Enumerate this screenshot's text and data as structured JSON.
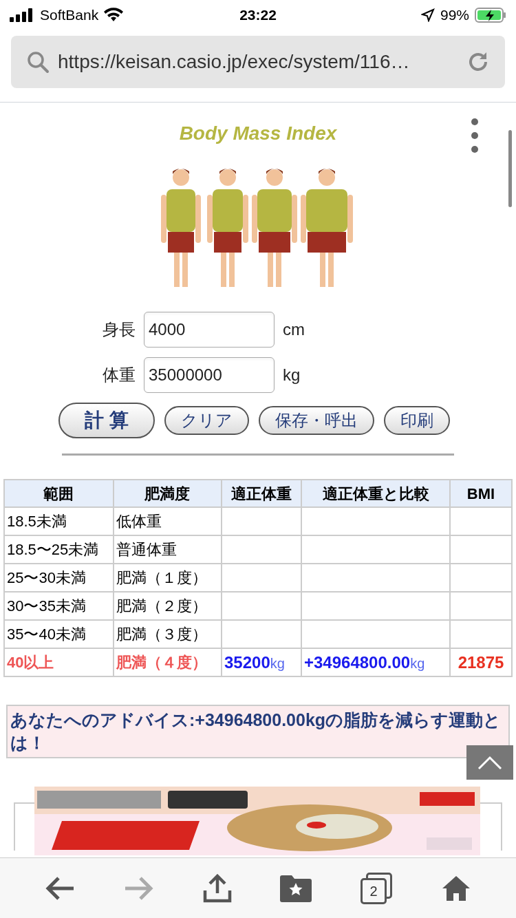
{
  "status_bar": {
    "carrier": "SoftBank",
    "time": "23:22",
    "battery": "99%"
  },
  "url_bar": {
    "url": "https://keisan.casio.jp/exec/system/116…"
  },
  "logo": {
    "title": "Body Mass Index"
  },
  "form": {
    "fields": [
      {
        "label": "身長",
        "value": "4000",
        "unit": "cm"
      },
      {
        "label": "体重",
        "value": "35000000",
        "unit": "kg"
      }
    ],
    "buttons": [
      {
        "label": "計 算",
        "kind": "primary"
      },
      {
        "label": "クリア",
        "kind": "secondary"
      },
      {
        "label": "保存・呼出",
        "kind": "secondary"
      },
      {
        "label": "印刷",
        "kind": "secondary"
      }
    ]
  },
  "table": {
    "columns": [
      "範囲",
      "肥満度",
      "適正体重",
      "適正体重と比較",
      "BMI"
    ],
    "rows": [
      {
        "range": "18.5未満",
        "grade": "低体重",
        "selected": false
      },
      {
        "range": "18.5〜25未満",
        "grade": "普通体重",
        "selected": false
      },
      {
        "range": "25〜30未満",
        "grade": "肥満（１度）",
        "selected": false
      },
      {
        "range": "30〜35未満",
        "grade": "肥満（２度）",
        "selected": false
      },
      {
        "range": "35〜40未満",
        "grade": "肥満（３度）",
        "selected": false
      },
      {
        "range": "40以上",
        "grade": "肥満（４度）",
        "selected": true,
        "ideal_weight": "35200",
        "ideal_unit": "kg",
        "difference": "+34964800.00",
        "difference_unit": "kg",
        "bmi": "21875"
      }
    ]
  },
  "advice": "あなたへのアドバイス:+34964800.00kgの脂肪を減らす運動とは！",
  "toolbar": {
    "tab_count": "2"
  }
}
